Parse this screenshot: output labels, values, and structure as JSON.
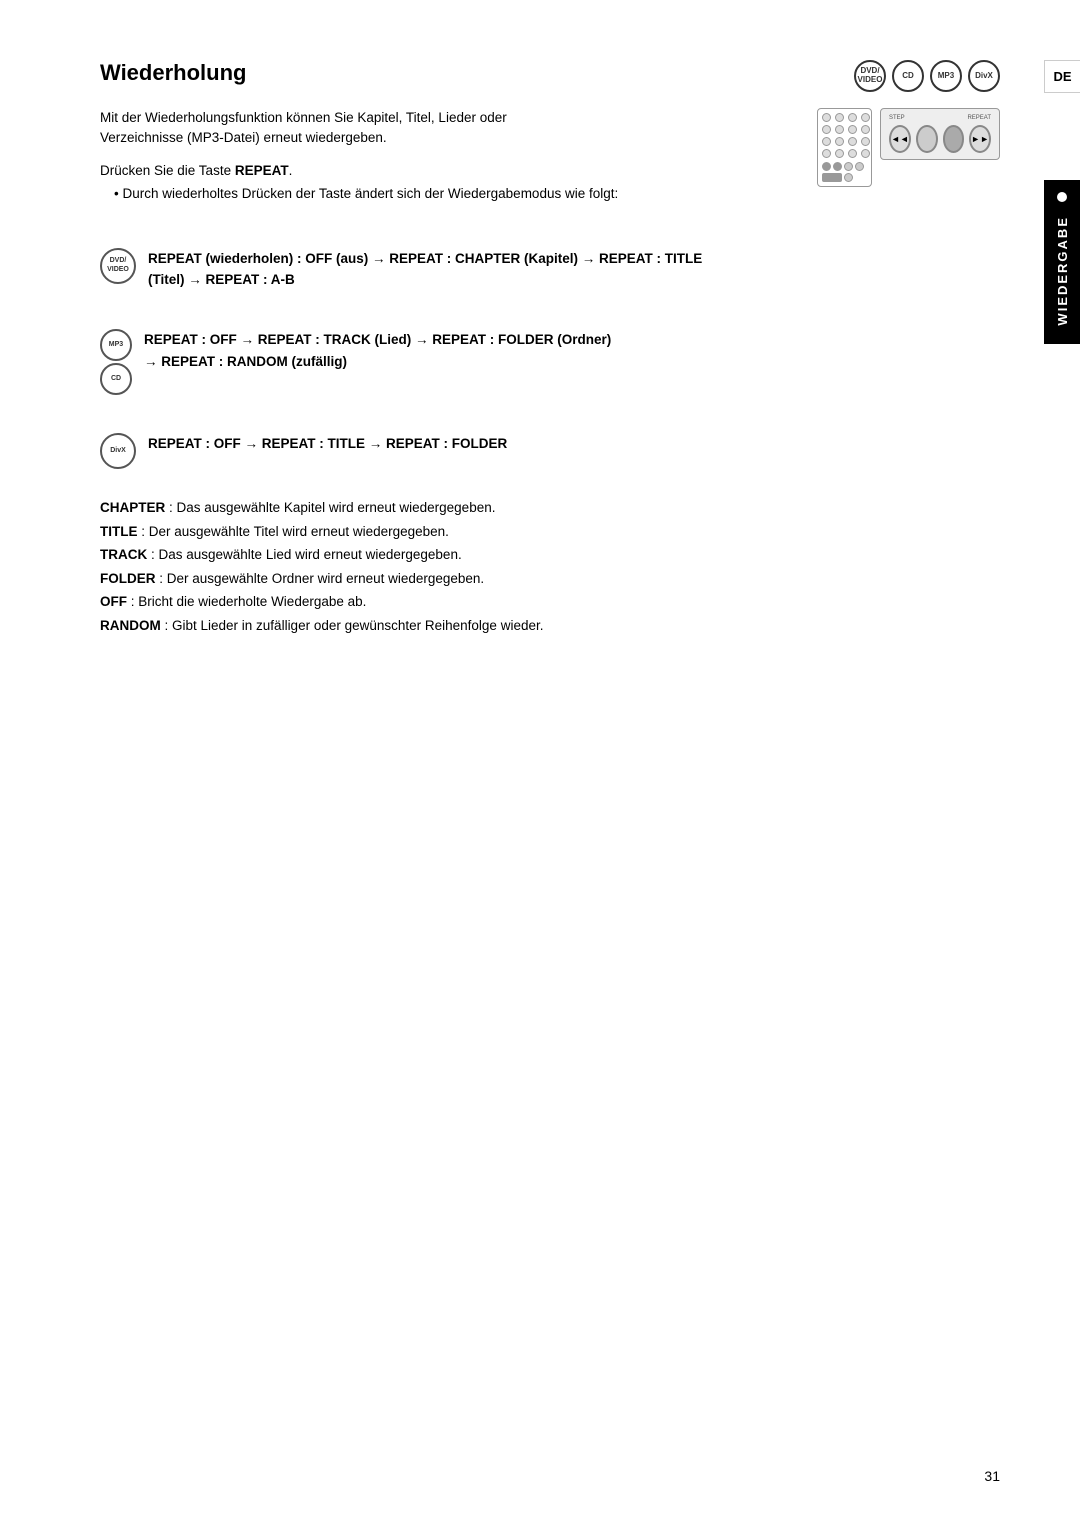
{
  "page": {
    "title": "Wiederholung",
    "page_number": "31",
    "sidebar_label": "WIEDERGABE",
    "de_label": "DE"
  },
  "formats": [
    {
      "id": "dvd",
      "label": "DVD/\nVIDEO"
    },
    {
      "id": "cd",
      "label": "CD"
    },
    {
      "id": "mp3",
      "label": "MP3"
    },
    {
      "id": "divx",
      "label": "DivX"
    }
  ],
  "intro": {
    "text": "Mit der Wiederholungsfunktion können Sie Kapitel, Titel, Lieder oder Verzeichnisse (MP3-Datei) erneut wiedergeben.",
    "drucken": "Drücken Sie die Taste REPEAT.",
    "bullet": "Durch wiederholtes Drücken der Taste ändert sich der Wiedergabemodus wie folgt:"
  },
  "repeat_blocks": [
    {
      "icon_line1": "DVD",
      "icon_line2": "VIDEO",
      "text": "REPEAT (wiederholen) : OFF (aus) → REPEAT : CHAPTER (Kapitel) → REPEAT : TITLE (Titel) → REPEAT : A-B"
    },
    {
      "icon_line1": "MP3",
      "icon_line2": "CD",
      "text": "REPEAT : OFF → REPEAT : TRACK (Lied) → REPEAT : FOLDER (Ordner) → REPEAT : RANDOM (zufällig)"
    },
    {
      "icon_line1": "DivX",
      "icon_line2": "",
      "text": "REPEAT : OFF → REPEAT : TITLE → REPEAT : FOLDER"
    }
  ],
  "descriptions": [
    {
      "term": "CHAPTER",
      "desc": ": Das ausgewählte Kapitel wird erneut wiedergegeben."
    },
    {
      "term": "TITLE",
      "desc": ": Der ausgewählte Titel wird erneut wiedergegeben."
    },
    {
      "term": "TRACK",
      "desc": ": Das ausgewählte Lied wird erneut wiedergegeben."
    },
    {
      "term": "FOLDER",
      "desc": ": Der ausgewählte Ordner wird erneut wiedergegeben."
    },
    {
      "term": "OFF",
      "desc": ": Bricht die wiederholte Wiedergabe ab."
    },
    {
      "term": "RANDOM",
      "desc": ": Gibt Lieder in zufälliger oder gewünschter Reihenfolge wieder."
    }
  ]
}
